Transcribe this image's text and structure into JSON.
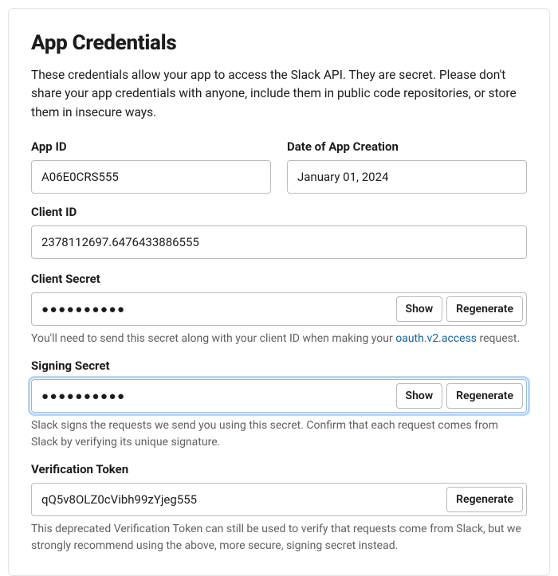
{
  "heading": "App Credentials",
  "description": "These credentials allow your app to access the Slack API. They are secret. Please don't share your app credentials with anyone, include them in public code repositories, or store them in insecure ways.",
  "appId": {
    "label": "App ID",
    "value": "A06E0CRS555"
  },
  "dateCreated": {
    "label": "Date of App Creation",
    "value": "January 01, 2024"
  },
  "clientId": {
    "label": "Client ID",
    "value": "2378112697.6476433886555"
  },
  "clientSecret": {
    "label": "Client Secret",
    "masked": "●●●●●●●●●●",
    "showLabel": "Show",
    "regenLabel": "Regenerate",
    "helperPrefix": "You'll need to send this secret along with your client ID when making your ",
    "helperLink": "oauth.v2.access",
    "helperSuffix": " request."
  },
  "signingSecret": {
    "label": "Signing Secret",
    "masked": "●●●●●●●●●●",
    "showLabel": "Show",
    "regenLabel": "Regenerate",
    "helper": "Slack signs the requests we send you using this secret. Confirm that each request comes from Slack by verifying its unique signature."
  },
  "verificationToken": {
    "label": "Verification Token",
    "value": "qQ5v8OLZ0cVibh99zYjeg555",
    "regenLabel": "Regenerate",
    "helper": "This deprecated Verification Token can still be used to verify that requests come from Slack, but we strongly recommend using the above, more secure, signing secret instead."
  }
}
